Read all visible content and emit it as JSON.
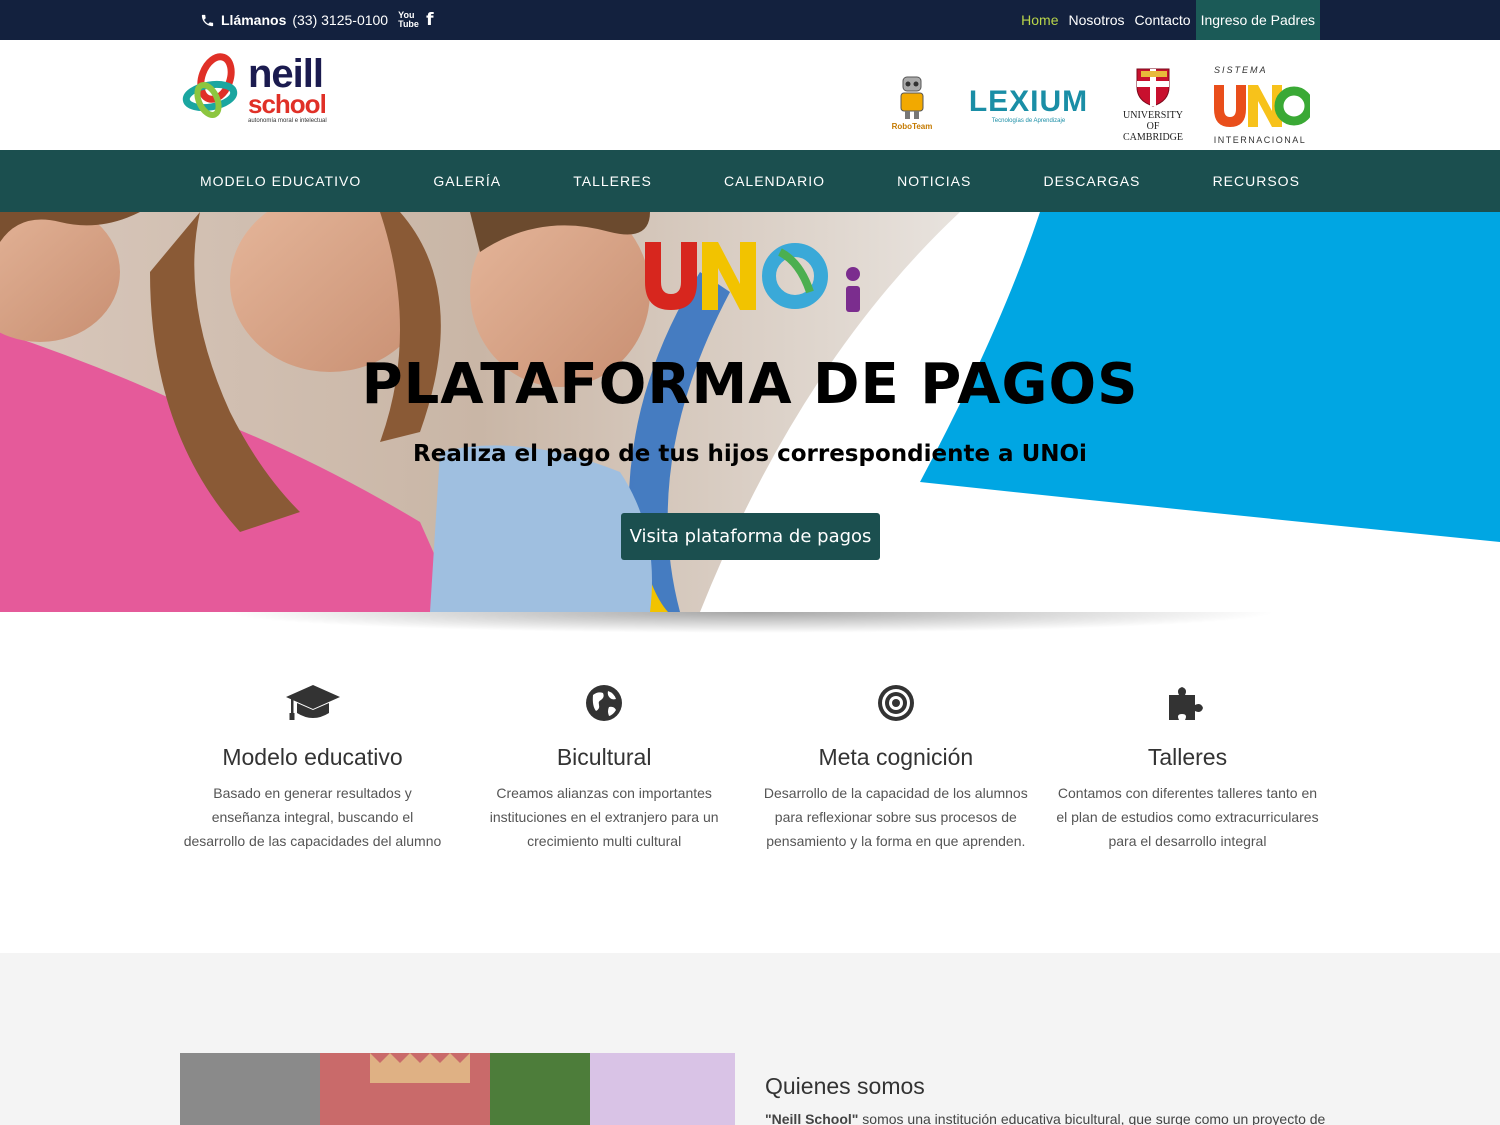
{
  "topbar": {
    "phone_label": "Llámanos",
    "phone_number": "(33) 3125-0100",
    "youtube_label": "You\nTube",
    "facebook_label": "f",
    "nav": [
      {
        "label": "Home",
        "active": true
      },
      {
        "label": "Nosotros"
      },
      {
        "label": "Contacto"
      },
      {
        "label": "Ingreso de Padres"
      }
    ]
  },
  "header": {
    "logo_line1": "neill",
    "logo_line2": "school",
    "logo_tagline": "autonomía moral e intelectual",
    "partners": {
      "robot_label": "RoboTeam",
      "lexium_name": "LEXIUM",
      "lexium_sub": "Tecnologías de Aprendizaje",
      "cambridge_line1": "UNIVERSITY OF",
      "cambridge_line2": "CAMBRIDGE",
      "uno_top": "SISTEMA",
      "uno_bottom": "INTERNACIONAL"
    }
  },
  "mainnav": [
    "MODELO EDUCATIVO",
    "GALERÍA",
    "TALLERES",
    "CALENDARIO",
    "NOTICIAS",
    "DESCARGAS",
    "RECURSOS"
  ],
  "hero": {
    "title": "PLATAFORMA DE PAGOS",
    "subtitle": "Realiza el pago de tus hijos correspondiente a UNOi",
    "cta": "Visita plataforma de pagos",
    "accent_color": "#00a6e3"
  },
  "features": [
    {
      "icon": "graduation-cap-icon",
      "title": "Modelo educativo",
      "text": "Basado en generar resultados y enseñanza integral, buscando el desarrollo de las capacidades del alumno"
    },
    {
      "icon": "globe-icon",
      "title": "Bicultural",
      "text": "Creamos alianzas con importantes instituciones en el extranjero para un crecimiento multi cultural"
    },
    {
      "icon": "target-icon",
      "title": "Meta cognición",
      "text": "Desarrollo de la capacidad de los alumnos para reflexionar sobre sus procesos de pensamiento y la forma en que aprenden."
    },
    {
      "icon": "puzzle-icon",
      "title": "Talleres",
      "text": "Contamos con diferentes talleres tanto en el plan de estudios como extracurriculares para el desarrollo integral"
    }
  ],
  "about": {
    "title": "Quienes somos",
    "text_bold": "\"Neill School\"",
    "text_rest": " somos una institución educativa bicultural, que surge como un proyecto de"
  },
  "colors": {
    "topbar": "#13213e",
    "nav": "#1b4f4f",
    "active_link": "#b9d54a"
  }
}
